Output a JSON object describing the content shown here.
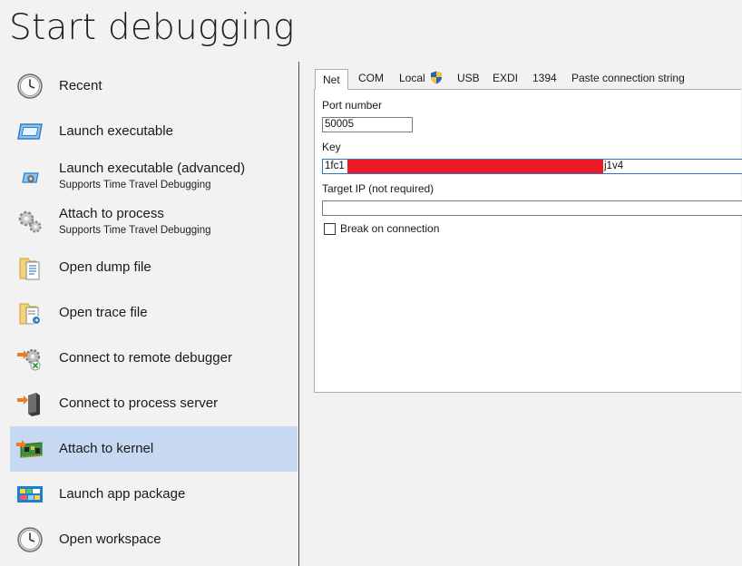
{
  "page": {
    "title": "Start debugging"
  },
  "sidebar": {
    "items": [
      {
        "label": "Recent",
        "icon": "clock-icon"
      },
      {
        "label": "Launch executable",
        "icon": "window-icon"
      },
      {
        "label": "Launch executable (advanced)",
        "sublabel": "Supports Time Travel Debugging",
        "icon": "window-gear-icon"
      },
      {
        "label": "Attach to process",
        "sublabel": "Supports Time Travel Debugging",
        "icon": "gears-icon"
      },
      {
        "label": "Open dump file",
        "icon": "dump-file-icon"
      },
      {
        "label": "Open trace file",
        "icon": "trace-file-icon"
      },
      {
        "label": "Connect to remote debugger",
        "icon": "remote-debugger-icon"
      },
      {
        "label": "Connect to process server",
        "icon": "process-server-icon"
      },
      {
        "label": "Attach to kernel",
        "icon": "kernel-board-icon",
        "selected": true
      },
      {
        "label": "Launch app package",
        "icon": "app-package-icon"
      },
      {
        "label": "Open workspace",
        "icon": "clock-icon"
      }
    ]
  },
  "kernel": {
    "tabs": [
      {
        "label": "Net",
        "active": true
      },
      {
        "label": "COM"
      },
      {
        "label": "Local",
        "icon": "uac-shield-icon"
      },
      {
        "label": "USB"
      },
      {
        "label": "EXDI"
      },
      {
        "label": "1394"
      },
      {
        "label": "Paste connection string"
      }
    ],
    "port_label": "Port number",
    "port_value": "50005",
    "key_label": "Key",
    "key_prefix": "1fc1",
    "key_suffix": "j1v4",
    "target_ip_label": "Target IP (not required)",
    "target_ip_value": "",
    "break_label": "Break on connection",
    "break_checked": false
  },
  "colors": {
    "selected_bg": "#c6d8f2",
    "redaction": "#ee1b24",
    "focus_border": "#2e73c8"
  }
}
